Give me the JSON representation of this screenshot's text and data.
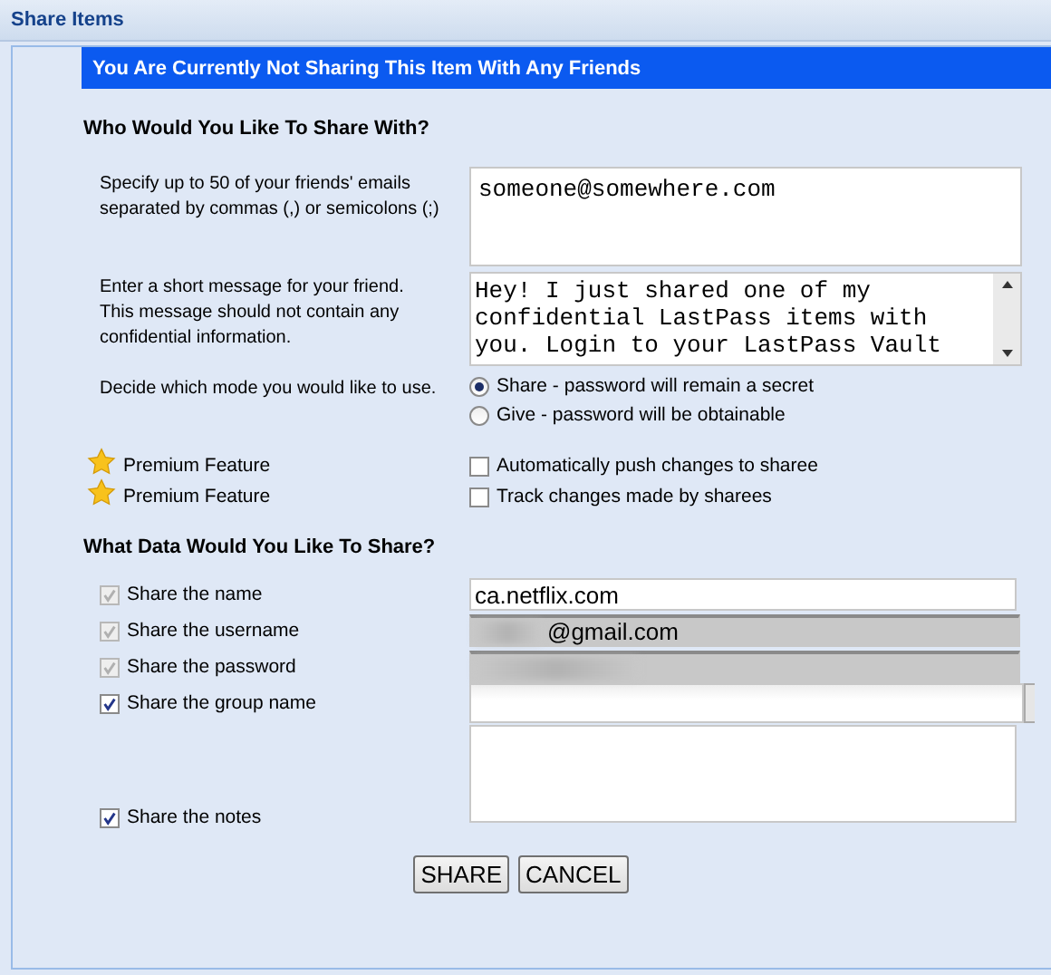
{
  "window": {
    "title": "Share Items"
  },
  "banner": "You Are Currently Not Sharing This Item With Any Friends",
  "recipients": {
    "heading": "Who Would You Like To Share With?",
    "emails": {
      "label": "Specify up to 50 of your friends' emails separated by commas (,) or semicolons (;)",
      "value": "someone@somewhere.com"
    },
    "message": {
      "label": "Enter a short message for your friend.  This message should not contain any confidential information.",
      "value": "Hey! I just shared one of my confidential LastPass items with you. Login to your LastPass Vault"
    },
    "mode": {
      "label": "Decide which mode you would like to use.",
      "options": [
        {
          "label": "Share - password will remain a secret",
          "selected": true
        },
        {
          "label": "Give - password will be obtainable",
          "selected": false
        }
      ]
    },
    "premium": [
      {
        "badge": "Premium Feature",
        "label": "Automatically push changes to sharee",
        "checked": false
      },
      {
        "badge": "Premium Feature",
        "label": "Track changes made by sharees",
        "checked": false
      }
    ]
  },
  "data": {
    "heading": "What Data Would You Like To Share?",
    "rows": [
      {
        "kind": "text",
        "label": "Share the name",
        "checked": true,
        "disabled": true,
        "value": "ca.netflix.com"
      },
      {
        "kind": "redacted",
        "label": "Share the username",
        "checked": true,
        "disabled": true,
        "value": "@gmail.com"
      },
      {
        "kind": "redacted",
        "label": "Share the password",
        "checked": true,
        "disabled": true
      },
      {
        "kind": "combo",
        "label": "Share the group name",
        "checked": true,
        "disabled": false
      },
      {
        "kind": "notes",
        "label": "Share the notes",
        "checked": true,
        "disabled": false
      }
    ]
  },
  "buttons": [
    "SHARE",
    "CANCEL"
  ]
}
